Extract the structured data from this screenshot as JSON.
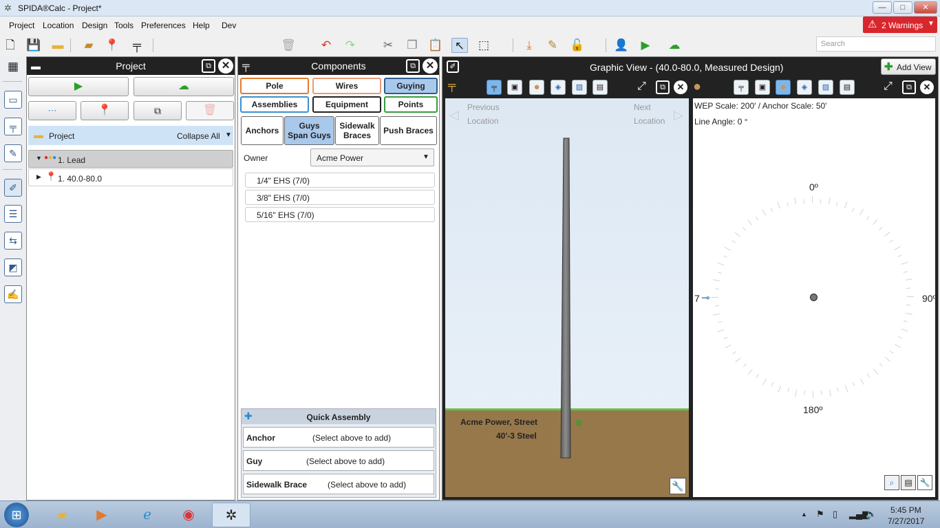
{
  "window": {
    "title": "SPIDA®Calc - Project*",
    "min": "—",
    "max": "□",
    "close": "✕"
  },
  "menu": [
    "Project",
    "Location",
    "Design",
    "Tools",
    "Preferences",
    "Help",
    "Dev"
  ],
  "warnings": {
    "label": "2 Warnings",
    "color": "#d8262d"
  },
  "search": {
    "placeholder": "Search"
  },
  "project_panel": {
    "title": "Project",
    "folder_label": "Project",
    "collapse_label": "Collapse All",
    "tree": [
      {
        "label": "1. Lead",
        "selected": true
      },
      {
        "label": "1. 40.0-80.0",
        "selected": false
      }
    ]
  },
  "components_panel": {
    "title": "Components",
    "tabs": [
      {
        "label": "Pole",
        "color": "#e07a2e"
      },
      {
        "label": "Wires",
        "color": "#e89a7a"
      },
      {
        "label": "Guying",
        "color": "#2c5d8a"
      },
      {
        "label": "Assemblies",
        "color": "#3a8fd0"
      },
      {
        "label": "Equipment",
        "color": "#222222"
      },
      {
        "label": "Points",
        "color": "#3a9a3a"
      }
    ],
    "subtabs": [
      "Anchors",
      "Guys\nSpan Guys",
      "Sidewalk\nBraces",
      "Push Braces"
    ],
    "owner_label": "Owner",
    "owner_value": "Acme Power",
    "items": [
      "1/4\" EHS (7/0)",
      "3/8\" EHS (7/0)",
      "5/16\" EHS (7/0)"
    ],
    "quick_assembly": {
      "title": "Quick Assembly",
      "rows": [
        {
          "label": "Anchor",
          "value": "(Select above to add)"
        },
        {
          "label": "Guy",
          "value": "(Select above to add)"
        },
        {
          "label": "Sidewalk Brace",
          "value": "(Select above to add)"
        }
      ]
    }
  },
  "graphic_view": {
    "title": "Graphic View - (40.0-80.0, Measured Design)",
    "add_view": "Add View",
    "prev": [
      "Previous",
      "Location"
    ],
    "next": [
      "Next",
      "Location"
    ],
    "pole_owner": "Acme Power, Street",
    "pole_spec": "40'-3 Steel",
    "wep_scale": "WEP Scale: 200' / Anchor Scale: 50'",
    "line_angle": "Line Angle: 0 °",
    "angle_top": "0º",
    "angle_right": "90º",
    "angle_bottom": "180º",
    "angle_left": "7"
  },
  "taskbar": {
    "time": "5:45 PM",
    "date": "7/27/2017"
  }
}
